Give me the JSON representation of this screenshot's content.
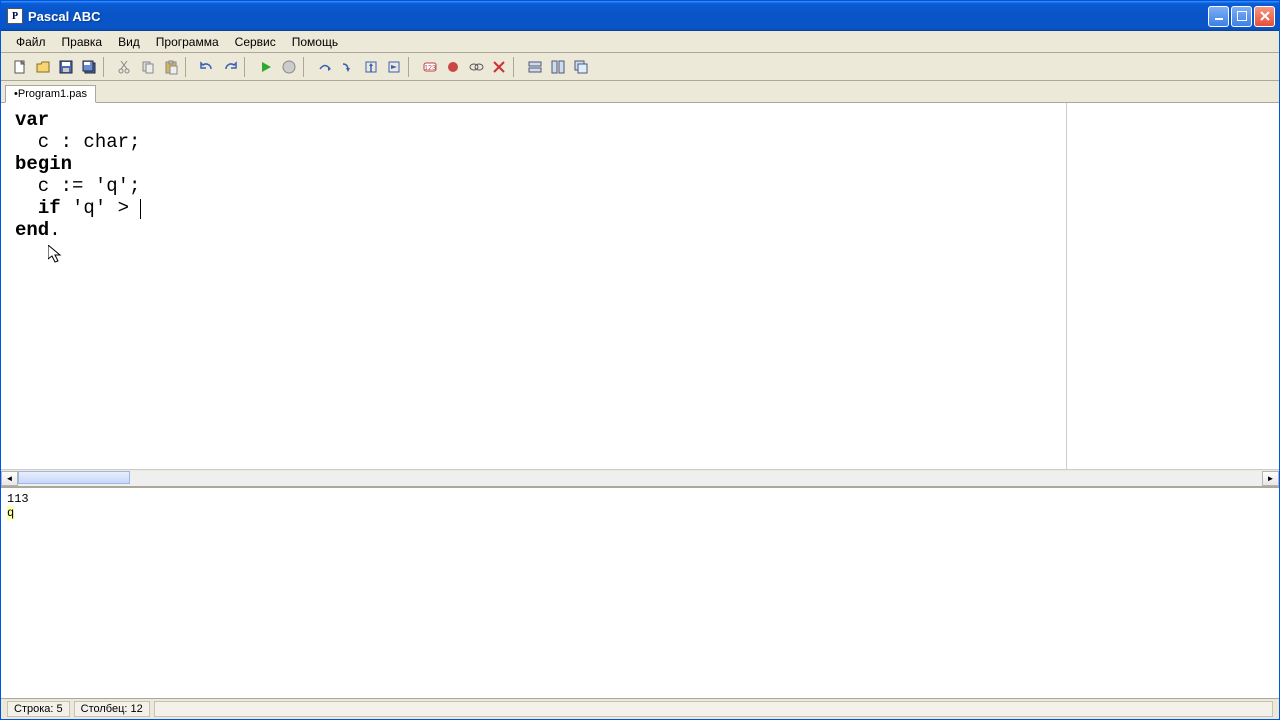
{
  "titlebar": {
    "title": "Pascal ABC",
    "app_icon_letter": "P"
  },
  "menu": {
    "file": "Файл",
    "edit": "Правка",
    "view": "Вид",
    "program": "Программа",
    "service": "Сервис",
    "help": "Помощь"
  },
  "tabs": {
    "active": "•Program1.pas"
  },
  "editor": {
    "l1_kw": "var",
    "l2": "  c : char;",
    "l3_kw": "begin",
    "l4": "  c := 'q';",
    "l5a": "  ",
    "l5_kw": "if",
    "l5b": " 'q' > ",
    "l6_kw": "end",
    "l6b": "."
  },
  "console": {
    "line1": "113",
    "line2": "q"
  },
  "status": {
    "line_label": "Строка: ",
    "line_val": "5",
    "col_label": "Столбец: ",
    "col_val": "12"
  },
  "toolbar_icons": {
    "new": "new-file",
    "open": "open-file",
    "save": "save-file",
    "saveall": "save-all",
    "cut": "cut",
    "copy": "copy",
    "paste": "paste",
    "undo": "undo",
    "redo": "redo",
    "run": "run",
    "stop": "stop",
    "stepover": "step-over",
    "stepinto": "step-into",
    "stepout": "step-out",
    "runtoline": "run-to-cursor",
    "bp1": "toggle-breakpoint-num",
    "bp2": "toggle-breakpoint",
    "watch": "watch",
    "clear": "clear-breakpoints",
    "w1": "tile-horizontal",
    "w2": "tile-vertical",
    "w3": "cascade"
  }
}
